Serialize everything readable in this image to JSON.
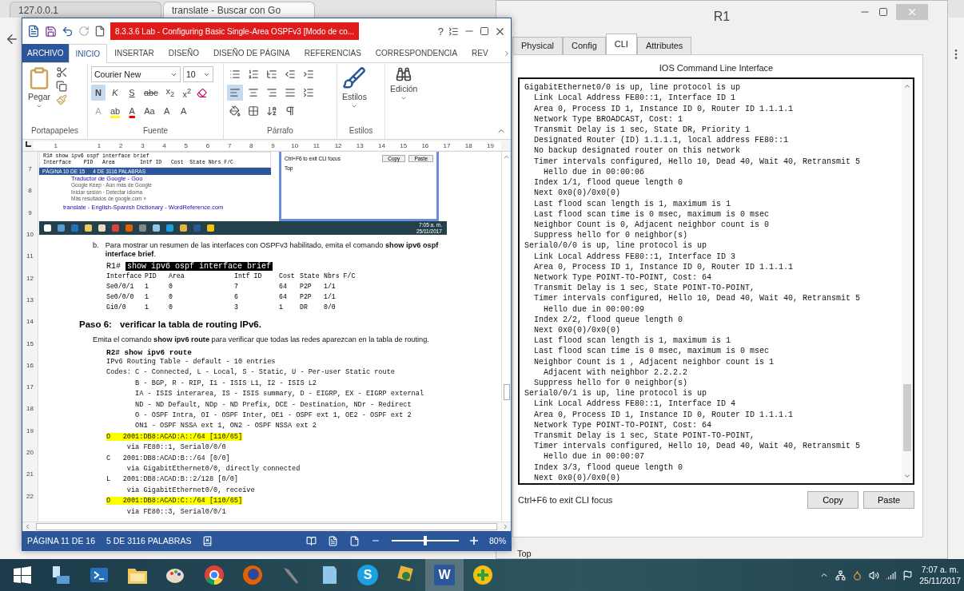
{
  "browser": {
    "tabs": [
      {
        "title": "127.0.0.1",
        "selected": false
      },
      {
        "title": "translate - Buscar con Go",
        "selected": true
      }
    ]
  },
  "word": {
    "title": "8.3.3.6 Lab - Configuring Basic Single-Area OSPFv3 [Modo de co...",
    "help": "?",
    "file_tab": "ARCHIVO",
    "menu_tabs": [
      {
        "label": "INICIO",
        "selected": true
      },
      {
        "label": "INSERTAR",
        "selected": false
      },
      {
        "label": "DISEÑO",
        "selected": false
      },
      {
        "label": "DISEÑO DE PÁGINA",
        "selected": false
      },
      {
        "label": "REFERENCIAS",
        "selected": false
      },
      {
        "label": "CORRESPONDENCIA",
        "selected": false
      },
      {
        "label": "REV",
        "selected": false
      }
    ],
    "ribbon": {
      "paste": "Pegar",
      "font": "Courier New",
      "size": "10",
      "format_buttons": [
        {
          "kind": "bold",
          "label": "N",
          "selected": true
        },
        {
          "kind": "italic",
          "label": "K",
          "selected": false
        },
        {
          "kind": "underline",
          "label": "S",
          "selected": false
        },
        {
          "kind": "strike",
          "label": "abc",
          "selected": false
        },
        {
          "kind": "subscript",
          "label": "x$_{2}$",
          "selected": false
        },
        {
          "kind": "superscript",
          "label": "x$^{2}$",
          "selected": false
        }
      ],
      "effect_buttons": [
        {
          "kind": "effects",
          "label": "A"
        },
        {
          "kind": "highlight",
          "label": "ab"
        },
        {
          "kind": "color",
          "label": "A"
        },
        {
          "kind": "case",
          "label": "Aa"
        },
        {
          "kind": "grow",
          "label": "A"
        },
        {
          "kind": "shrink",
          "label": "A"
        }
      ],
      "align_buttons": [
        {
          "kind": "left",
          "selected": true
        },
        {
          "kind": "center",
          "selected": false
        },
        {
          "kind": "right",
          "selected": false
        },
        {
          "kind": "justify",
          "selected": false
        }
      ],
      "styles": "Estilos",
      "editing": "Edición",
      "groups": [
        "Portapapeles",
        "Fuente",
        "Párrafo",
        "Estilos"
      ]
    },
    "ruler": [
      "1",
      "1",
      "2",
      "3",
      "4",
      "5",
      "6",
      "7",
      "8",
      "9",
      "10",
      "11",
      "12",
      "13",
      "14",
      "15",
      "16",
      "17",
      "18",
      "19"
    ],
    "vruler": [
      "7",
      "8",
      "9",
      "10",
      "11",
      "12",
      "13",
      "14",
      "15",
      "16",
      "17",
      "18",
      "19",
      "20",
      "21",
      "22"
    ],
    "embedded_shot": {
      "cli_lines": [
        "R1# show ipv6 ospf interface brief",
        "Interface    PID   Area        Intf ID   Cost  State Nbrs F/C"
      ],
      "status": [
        "PÁGINA 10 DE 15",
        "4 DE 3116 PALABRAS"
      ],
      "results": [
        "Traductor de Google - Goo",
        "Google Keep · Aún más de Google",
        "Iniciar sesión · Detectar idioma",
        "Más resultados de google.com »"
      ],
      "link": "translate - English-Spanish Dictionary - WordReference.com",
      "dialog_hint": "Ctrl+F6 to exit CLI focus",
      "dialog_buttons": [
        "Copy",
        "Paste"
      ],
      "dialog_top": "Top",
      "clock": [
        "7:05 a. m.",
        "25/11/2017"
      ]
    },
    "document": {
      "step_marker": "b.",
      "step_text": "Para mostrar un resumen de las interfaces con OSPFv3 habilitado, emita el comando **show ipv6 ospf interface brief**.",
      "prompt1": "R1#",
      "command1": "show ipv6 ospf interface brief",
      "table": {
        "columns": [
          "Interface",
          "PID",
          "Area",
          "Intf ID",
          "Cost",
          "State",
          "Nbrs F/C"
        ],
        "rows": [
          [
            "Se0/0/1",
            "1",
            "0",
            "7",
            "64",
            "P2P",
            "1/1"
          ],
          [
            "Se0/0/0",
            "1",
            "0",
            "6",
            "64",
            "P2P",
            "1/1"
          ],
          [
            "Gi0/0",
            "1",
            "0",
            "3",
            "1",
            "DR",
            "0/0"
          ]
        ]
      },
      "heading_num": "Paso 6:",
      "heading_text": "verificar la tabla de routing IPv6.",
      "paragraph": "Emita el comando **show ipv6 route** para verificar que todas las redes aparezcan en la tabla de routing.",
      "command2": "R2# show ipv6 route",
      "output": [
        {
          "text": "IPv6 Routing Table - default - 10 entries",
          "highlight": false
        },
        {
          "text": "Codes: C - Connected, L - Local, S - Static, U - Per-user Static route",
          "highlight": false
        },
        {
          "text": "       B - BGP, R - RIP, I1 - ISIS L1, I2 - ISIS L2",
          "highlight": false
        },
        {
          "text": "       IA - ISIS interarea, IS - ISIS summary, D - EIGRP, EX - EIGRP external",
          "highlight": false
        },
        {
          "text": "       ND - ND Default, NDp - ND Prefix, DCE - Destination, NDr - Redirect",
          "highlight": false
        },
        {
          "text": "       O - OSPF Intra, OI - OSPF Inter, OE1 - OSPF ext 1, OE2 - OSPF ext 2",
          "highlight": false
        },
        {
          "text": "       ON1 - OSPF NSSA ext 1, ON2 - OSPF NSSA ext 2",
          "highlight": false
        },
        {
          "text": "O   2001:DB8:ACAD:A::/64 [110/65]",
          "highlight": true
        },
        {
          "text": "     via FE80::1, Serial0/0/0",
          "highlight": false
        },
        {
          "text": "C   2001:DB8:ACAD:B::/64 [0/0]",
          "highlight": false
        },
        {
          "text": "     via GigabitEthernet0/0, directly connected",
          "highlight": false
        },
        {
          "text": "L   2001:DB8:ACAD:B::2/128 [0/0]",
          "highlight": false
        },
        {
          "text": "     via GigabitEthernet0/0, receive",
          "highlight": false
        },
        {
          "text": "O   2001:DB8:ACAD:C::/64 [110/65]",
          "highlight": true
        },
        {
          "text": "     via FE80::3, Serial0/0/1",
          "highlight": false
        }
      ]
    },
    "status": {
      "page": "PÁGINA 11 DE 16",
      "words": "5 DE 3116 PALABRAS",
      "zoom": "80%",
      "level": 0.5
    }
  },
  "r1": {
    "title": "R1",
    "tabs": [
      {
        "label": "Physical",
        "selected": false
      },
      {
        "label": "Config",
        "selected": false
      },
      {
        "label": "CLI",
        "selected": true
      },
      {
        "label": "Attributes",
        "selected": false
      }
    ],
    "header": "IOS Command Line Interface",
    "lines": [
      "GigabitEthernet0/0 is up, line protocol is up",
      "  Link Local Address FE80::1, Interface ID 1",
      "  Area 0, Process ID 1, Instance ID 0, Router ID 1.1.1.1",
      "  Network Type BROADCAST, Cost: 1",
      "  Transmit Delay is 1 sec, State DR, Priority 1",
      "  Designated Router (ID) 1.1.1.1, local address FE80::1",
      "  No backup designated router on this network",
      "  Timer intervals configured, Hello 10, Dead 40, Wait 40, Retransmit 5",
      "    Hello due in 00:00:06",
      "  Index 1/1, flood queue length 0",
      "  Next 0x0(0)/0x0(0)",
      "  Last flood scan length is 1, maximum is 1",
      "  Last flood scan time is 0 msec, maximum is 0 msec",
      "  Neighbor Count is 0, Adjacent neighbor count is 0",
      "  Suppress hello for 0 neighbor(s)",
      "Serial0/0/0 is up, line protocol is up",
      "  Link Local Address FE80::1, Interface ID 3",
      "  Area 0, Process ID 1, Instance ID 0, Router ID 1.1.1.1",
      "  Network Type POINT-TO-POINT, Cost: 64",
      "  Transmit Delay is 1 sec, State POINT-TO-POINT,",
      "  Timer intervals configured, Hello 10, Dead 40, Wait 40, Retransmit 5",
      "    Hello due in 00:00:09",
      "  Index 2/2, flood queue length 0",
      "  Next 0x0(0)/0x0(0)",
      "  Last flood scan length is 1, maximum is 1",
      "  Last flood scan time is 0 msec, maximum is 0 msec",
      "  Neighbor Count is 1 , Adjacent neighbor count is 1",
      "    Adjacent with neighbor 2.2.2.2",
      "  Suppress hello for 0 neighbor(s)",
      "Serial0/0/1 is up, line protocol is up",
      "  Link Local Address FE80::1, Interface ID 4",
      "  Area 0, Process ID 1, Instance ID 0, Router ID 1.1.1.1",
      "  Network Type POINT-TO-POINT, Cost: 64",
      "  Transmit Delay is 1 sec, State POINT-TO-POINT,",
      "  Timer intervals configured, Hello 10, Dead 40, Wait 40, Retransmit 5",
      "    Hello due in 00:00:07",
      "  Index 3/3, flood queue length 0",
      "  Next 0x0(0)/0x0(0)"
    ],
    "hint": "Ctrl+F6 to exit CLI focus",
    "buttons": [
      "Copy",
      "Paste"
    ],
    "top_label": "Top"
  },
  "taskbar": {
    "apps": [
      {
        "kind": "start"
      },
      {
        "kind": "server"
      },
      {
        "kind": "powershell"
      },
      {
        "kind": "folder"
      },
      {
        "kind": "paint"
      },
      {
        "kind": "chrome"
      },
      {
        "kind": "firefox"
      },
      {
        "kind": "tool"
      },
      {
        "kind": "notepad"
      },
      {
        "kind": "letter",
        "label": "S",
        "color": "#1ba1e2"
      },
      {
        "kind": "tracer"
      },
      {
        "kind": "letter",
        "label": "W",
        "color": "#2b579a"
      },
      {
        "kind": "plus"
      }
    ],
    "time": "7:07 a. m.",
    "date": "25/11/2017"
  }
}
